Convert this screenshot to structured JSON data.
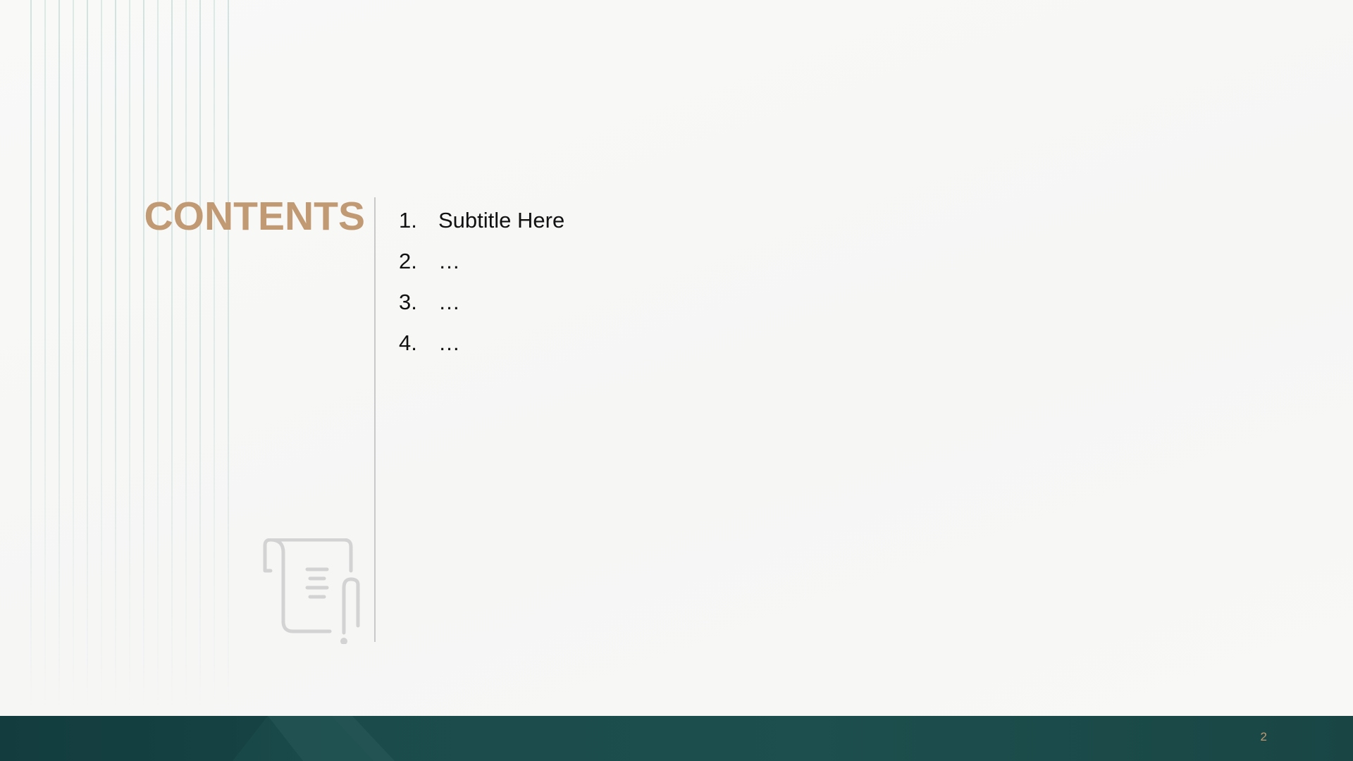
{
  "slide": {
    "title": "CONTENTS",
    "items": [
      {
        "num": "1.",
        "text": "Subtitle Here"
      },
      {
        "num": "2.",
        "text": "…"
      },
      {
        "num": "3.",
        "text": "…"
      },
      {
        "num": "4.",
        "text": "…"
      }
    ],
    "page_number": "2",
    "decor_icon": "scroll-document-icon"
  },
  "colors": {
    "accent": "#c19a73",
    "footer": "#1b4a4a",
    "background": "#f7f7f6",
    "stripe": "#bfd6d3",
    "icon": "#d3d3d3"
  }
}
